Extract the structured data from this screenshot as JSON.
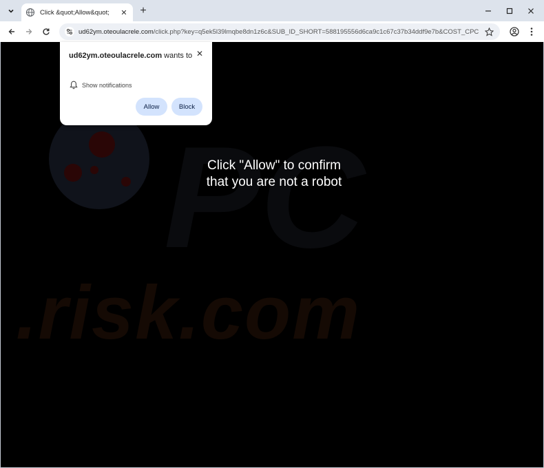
{
  "tab": {
    "title": "Click &quot;Allow&quot;",
    "close_label": "✕"
  },
  "new_tab_label": "+",
  "address": {
    "host": "ud62ym.oteoulacrele.com",
    "path": "/click.php?key=q5ek5l39lmqbe8dn1z6c&SUB_ID_SHORT=588195556d6ca9c1c67c37b34ddf9e7b&COST_CPC..."
  },
  "popup": {
    "site": "ud62ym.oteoulacrele.com",
    "wants_text": "wants to",
    "permission": "Show notifications",
    "allow_label": "Allow",
    "block_label": "Block",
    "close_label": "✕"
  },
  "page": {
    "line1": "Click \"Allow\" to confirm",
    "line2": "that you are not a robot",
    "watermark": ".risk.com",
    "watermark_pc": "PC"
  }
}
